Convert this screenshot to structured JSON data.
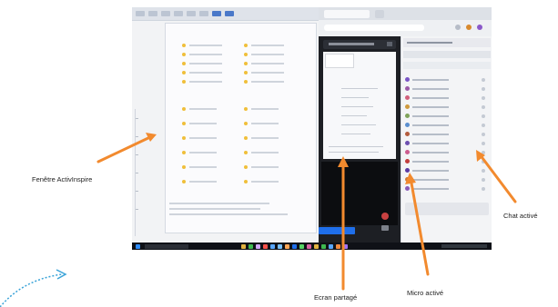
{
  "labels": {
    "activinspire": "Fenêtre ActivInspire",
    "shared_screen": "Ecran partagé",
    "mic": "Micro activé",
    "chat": "Chat activé"
  },
  "colors": {
    "arrow": "#f28a2e",
    "dotted_arrow": "#3aa3d8",
    "taskbar": "#0f1117",
    "share_button": "#1f6feb",
    "mic_active": "#c84141"
  },
  "icons": {
    "arrow": "orange-arrow-icon",
    "dotted": "dotted-curved-arrow-icon"
  }
}
